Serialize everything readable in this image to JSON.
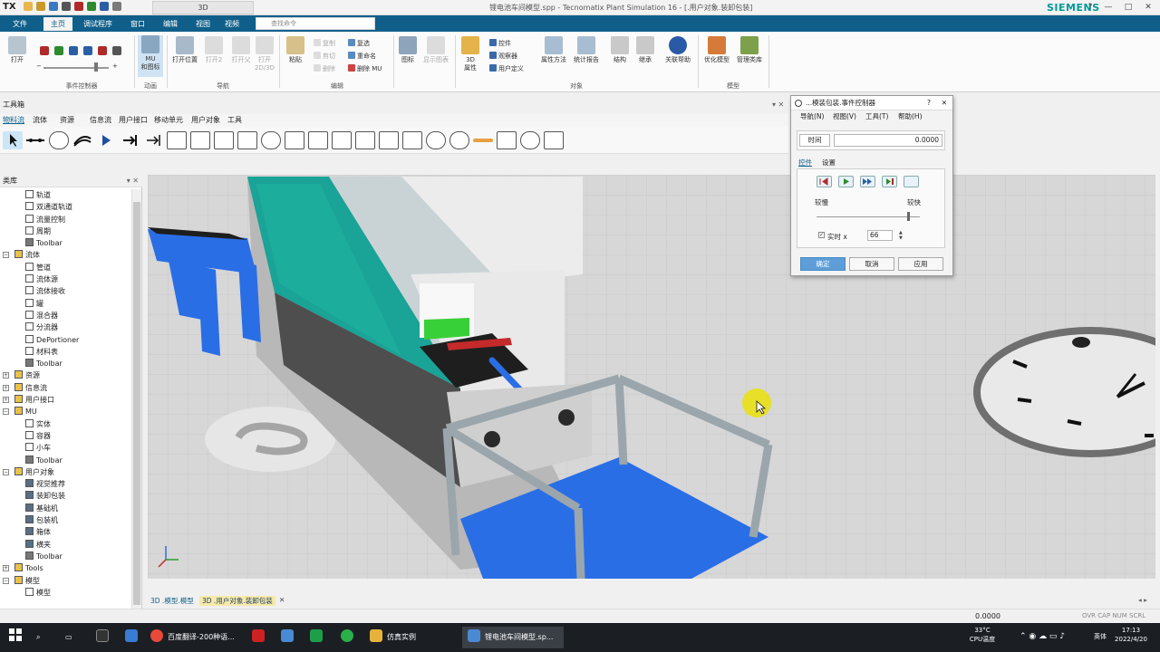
{
  "window": {
    "app_short": "TX",
    "context_tab": "3D",
    "title": "锂电池车间模型.spp - Tecnomatix Plant Simulation 16 - [.用户对象.装卸包装]",
    "brand": "SIEMENS",
    "controls": [
      "?",
      "—",
      "□",
      "✕"
    ]
  },
  "ribbon_tabs": [
    {
      "label": "文件",
      "active": false
    },
    {
      "label": "主页",
      "active": true
    },
    {
      "label": "调试程序",
      "active": false
    },
    {
      "label": "窗口",
      "active": false
    },
    {
      "label": "编辑",
      "active": false
    },
    {
      "label": "视图",
      "active": false
    },
    {
      "label": "视频",
      "active": false
    }
  ],
  "search_placeholder": "查找命令",
  "ribbon": {
    "open": "打开",
    "mu_line1": "MU",
    "mu_line2": "和图标",
    "nav_buttons": [
      "打开位置",
      "打开2",
      "打开父",
      "打开"
    ],
    "open_2d3d": "2D/3D",
    "paste": "粘贴",
    "edit_small": [
      "复制",
      "剪切",
      "删除"
    ],
    "edit_actions": [
      "复选",
      "重命名",
      "删除 MU"
    ],
    "icons_btn": "图标",
    "show_diagram": "显示图表",
    "attr3d_line1": "3D",
    "attr3d_line2": "属性",
    "control_small": [
      "控件",
      "观察器",
      "用户定义"
    ],
    "attr_methods": "属性方法",
    "stats": "统计报告",
    "structure": "结构",
    "inherit": "继承",
    "help": "关联帮助",
    "optimize": "优化模型",
    "manage_lib": "管理类库",
    "groups": {
      "event_controller": "事件控制器",
      "animation": "动画",
      "navigation": "导航",
      "edit": "编辑",
      "objects": "对象",
      "model": "模型"
    }
  },
  "toolbox": {
    "title": "工具箱",
    "tabs": [
      "物料流",
      "流体",
      "资源",
      "信息流",
      "用户接口",
      "移动单元",
      "用户对象",
      "工具"
    ],
    "active_tab": "物料流"
  },
  "library": {
    "title": "类库",
    "items": [
      {
        "label": "轨道",
        "level": 2,
        "icon": "track-icon"
      },
      {
        "label": "双通道轨道",
        "level": 2,
        "icon": "dual-track-icon"
      },
      {
        "label": "流量控制",
        "level": 2,
        "icon": "flow-control-icon"
      },
      {
        "label": "周期",
        "level": 2,
        "icon": "cycle-icon"
      },
      {
        "label": "Toolbar",
        "level": 2,
        "icon": "toolbar-icon"
      },
      {
        "label": "流体",
        "level": 1,
        "icon": "folder-icon",
        "expand": "−"
      },
      {
        "label": "管道",
        "level": 2,
        "icon": "pipe-icon"
      },
      {
        "label": "流体源",
        "level": 2,
        "icon": "fluid-source-icon"
      },
      {
        "label": "流体接收",
        "level": 2,
        "icon": "fluid-drain-icon"
      },
      {
        "label": "罐",
        "level": 2,
        "icon": "tank-icon"
      },
      {
        "label": "混合器",
        "level": 2,
        "icon": "mixer-icon"
      },
      {
        "label": "分流器",
        "level": 2,
        "icon": "splitter-icon"
      },
      {
        "label": "DePortioner",
        "level": 2,
        "icon": "deportioner-icon"
      },
      {
        "label": "材料表",
        "level": 2,
        "icon": "table-icon"
      },
      {
        "label": "Toolbar",
        "level": 2,
        "icon": "toolbar-icon"
      },
      {
        "label": "资源",
        "level": 1,
        "icon": "folder-icon",
        "expand": "+"
      },
      {
        "label": "信息流",
        "level": 1,
        "icon": "folder-icon",
        "expand": "+"
      },
      {
        "label": "用户接口",
        "level": 1,
        "icon": "folder-icon",
        "expand": "+"
      },
      {
        "label": "MU",
        "level": 1,
        "icon": "folder-icon",
        "expand": "−"
      },
      {
        "label": "实体",
        "level": 2,
        "icon": "entity-icon"
      },
      {
        "label": "容器",
        "level": 2,
        "icon": "container-icon"
      },
      {
        "label": "小车",
        "level": 2,
        "icon": "cart-icon"
      },
      {
        "label": "Toolbar",
        "level": 2,
        "icon": "toolbar-icon"
      },
      {
        "label": "用户对象",
        "level": 1,
        "icon": "folder-icon",
        "expand": "−"
      },
      {
        "label": "视觉推荐",
        "level": 2,
        "icon": "object-icon"
      },
      {
        "label": "装卸包装",
        "level": 2,
        "icon": "object-icon"
      },
      {
        "label": "基础机",
        "level": 2,
        "icon": "object-icon"
      },
      {
        "label": "包装机",
        "level": 2,
        "icon": "object-icon"
      },
      {
        "label": "箱体",
        "level": 2,
        "icon": "object-icon"
      },
      {
        "label": "横夹",
        "level": 2,
        "icon": "object-icon"
      },
      {
        "label": "Toolbar",
        "level": 2,
        "icon": "toolbar-icon"
      },
      {
        "label": "Tools",
        "level": 1,
        "icon": "folder-icon",
        "expand": "+"
      },
      {
        "label": "模型",
        "level": 1,
        "icon": "folder-icon",
        "expand": "−"
      },
      {
        "label": "模型",
        "level": 2,
        "icon": "frame-icon"
      }
    ]
  },
  "dialog": {
    "title": "...模装包装.事件控制器",
    "menu": [
      "导航(N)",
      "视图(V)",
      "工具(T)",
      "帮助(H)"
    ],
    "time_label": "时间",
    "time_value": "0.0000",
    "tabs": [
      "控件",
      "设置"
    ],
    "slow": "较慢",
    "fast": "较快",
    "realtime_label": "实时 x",
    "realtime_value": "66",
    "speed_fraction": 0.88,
    "buttons": [
      "确定",
      "取消",
      "应用"
    ]
  },
  "doc_tabs": [
    "3D .模型.模型",
    "3D .用户对象.装卸包装"
  ],
  "status": {
    "time": "0.0000",
    "indicators": "OVR  CAP  NUM  SCRL"
  },
  "taskbar": {
    "apps": [
      "百度翻译-200种语...",
      "仿真实例",
      "锂电池车间模型.sp..."
    ],
    "temp": "33°C",
    "cpu": "CPU温度",
    "ime": "英体",
    "time": "17:13",
    "date": "2022/4/20"
  },
  "colors": {
    "accent": "#0f5f8a",
    "brand": "#009999",
    "floor": "#d6d6d6",
    "machine_teal": "#1aa397",
    "conveyor_blue": "#2a6ee6"
  }
}
